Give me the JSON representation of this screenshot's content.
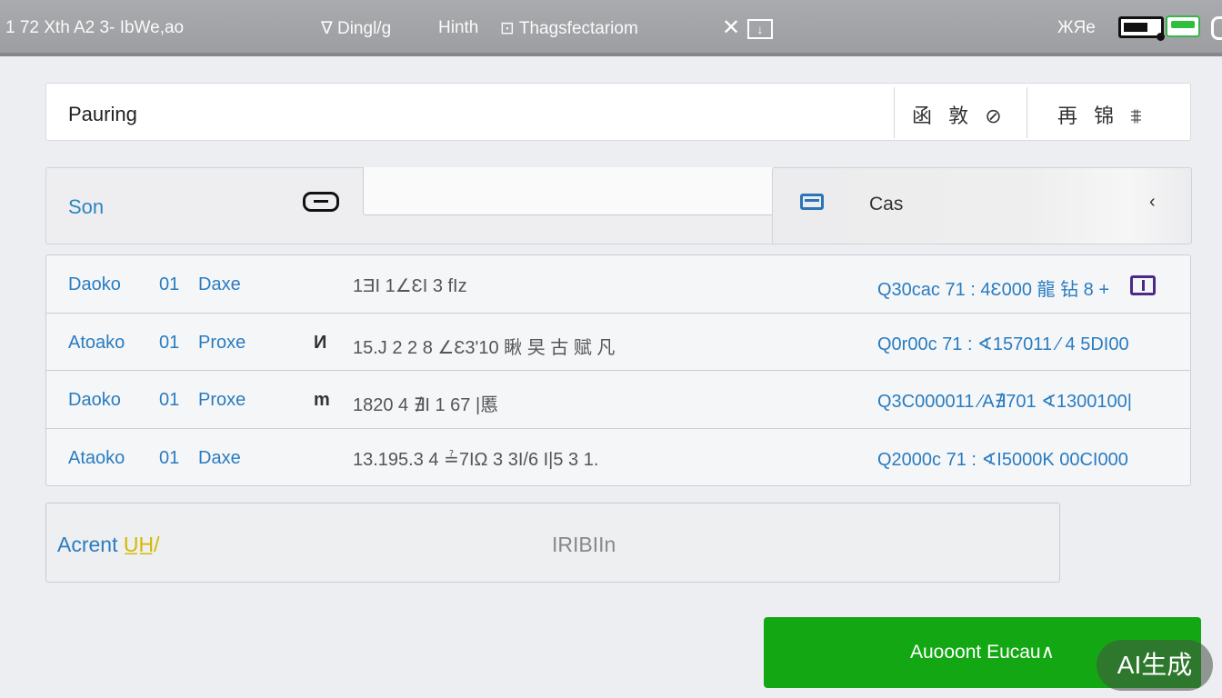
{
  "status_bar": {
    "left_text": "1 72  Xth  A2 3-   IbWe,ao",
    "nav_items": [
      "∇ Dingl/g",
      "Hinth",
      "⊡ Thagsfectariom"
    ],
    "close_symbol": "✕",
    "user_short": "ЖЯe",
    "icons": [
      "download-icon",
      "battery-icon",
      "wifi-icon"
    ]
  },
  "header": {
    "title": "Pauring",
    "actions_1": "函 敦 ⊘",
    "actions_2": "再 锦  ⩨"
  },
  "filters": {
    "label": "Son",
    "search_placeholder": "",
    "sort_label": "Cas",
    "sort_chevron": "‹"
  },
  "transactions": [
    {
      "name": "Daoko",
      "num": "01",
      "type": "Daxe",
      "mark": "",
      "desc": "1ƎI 1∠ƐI 3 fIz",
      "amount": "Q30cac 71 : 4Ɛ000  龍 钻 8 +"
    },
    {
      "name": "Atoako",
      "num": "01",
      "type": "Proxe",
      "mark": "И",
      "desc": "15.J 2 2 8 ∠Ɛ3'10 瞅 旲 古 赋 凡",
      "amount": "Q0r00c 71 : ∢157011  ⁄ 4 5DI00"
    },
    {
      "name": "Daoko",
      "num": "01",
      "type": "Proxe",
      "mark": "m",
      "desc": "1820 4 ∄I 1 67 |慝",
      "amount": "Q3C000011 ⁄A∄701  ∢1300100|"
    },
    {
      "name": "Ataoko",
      "num": "01",
      "type": "Daxe",
      "mark": "",
      "desc": "13.195.3 4 ≟7IΩ  3 3I/6  I|5 3 1.",
      "amount": "Q2000c 71 : ∢I5000K  00CI000"
    }
  ],
  "account": {
    "label": "Acrent",
    "label_highlight": "U̲H̲/",
    "value": "IRIBIIn"
  },
  "primary_button": {
    "label": "Auooont Eucau∧"
  },
  "watermark": "AI生成",
  "colors": {
    "accent_blue": "#2a7cc0",
    "primary_green": "#13a813",
    "background": "#eceef2"
  }
}
